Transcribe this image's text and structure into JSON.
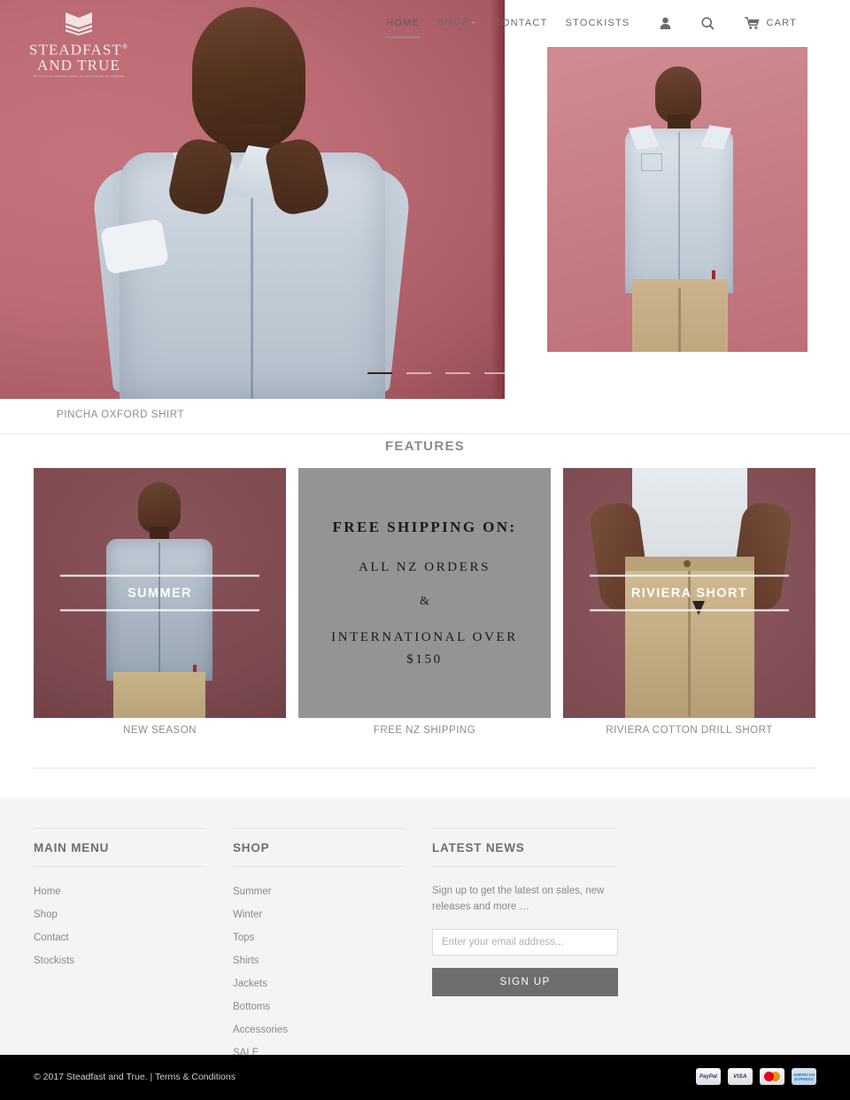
{
  "brand": {
    "name_line1": "STEADFAST",
    "name_line2": "AND TRUE",
    "registered": "®",
    "tagline": "THE ORIGINAL  FORTIFIED SHIRTS  ELABORATED BY ALL WORKERS",
    "logo_icon": "shield-book-icon"
  },
  "nav": {
    "items": [
      {
        "label": "HOME",
        "active": true
      },
      {
        "label": "SHOP",
        "active": false,
        "has_dropdown": true,
        "caret": "▾"
      },
      {
        "label": "CONTACT",
        "active": false
      },
      {
        "label": "STOCKISTS",
        "active": false
      }
    ],
    "icons": [
      {
        "name": "account-icon"
      },
      {
        "name": "search-icon"
      }
    ],
    "cart": {
      "label": "CART",
      "icon": "cart-icon"
    }
  },
  "hero": {
    "caption": "PINCHA OXFORD SHIRT",
    "slides_total": 4,
    "active_slide": 1
  },
  "features": {
    "title": "FEATURES",
    "items": [
      {
        "overlay_label": "SUMMER",
        "caption": "NEW SEASON"
      },
      {
        "overlay_label": "",
        "caption": "FREE NZ SHIPPING"
      },
      {
        "overlay_label": "RIVIERA SHORT",
        "caption": "RIVIERA COTTON DRILL SHORT"
      }
    ],
    "promo": {
      "line1": "FREE SHIPPING ON:",
      "line2": "ALL NZ ORDERS",
      "line3": "&",
      "line4": "INTERNATIONAL OVER $150"
    }
  },
  "footer": {
    "main_menu": {
      "heading": "MAIN MENU",
      "links": [
        "Home",
        "Shop",
        "Contact",
        "Stockists"
      ]
    },
    "shop": {
      "heading": "SHOP",
      "links": [
        "Summer",
        "Winter",
        "Tops",
        "Shirts",
        "Jackets",
        "Bottoms",
        "Accessories",
        "SALE"
      ]
    },
    "news": {
      "heading": "LATEST NEWS",
      "text": "Sign up to get the latest on sales, new releases and more …",
      "placeholder": "Enter your email address...",
      "button": "SIGN UP"
    }
  },
  "bottom": {
    "copyright": "© 2017 Steadfast and True. | ",
    "terms": "Terms & Conditions",
    "payments": [
      {
        "name": "paypal-icon",
        "label": "PayPal"
      },
      {
        "name": "visa-icon",
        "label": "VISA"
      },
      {
        "name": "mastercard-icon",
        "label": ""
      },
      {
        "name": "amex-icon",
        "label": "AMERICAN EXPRESS"
      }
    ]
  },
  "colors": {
    "hero_bg": "#bc6b74",
    "feature_bg": "#7d4a50",
    "promo_bg": "#949494",
    "footer_bg": "#f4f4f4",
    "bottom_bg": "#000000",
    "button": "#6e6e6e"
  }
}
